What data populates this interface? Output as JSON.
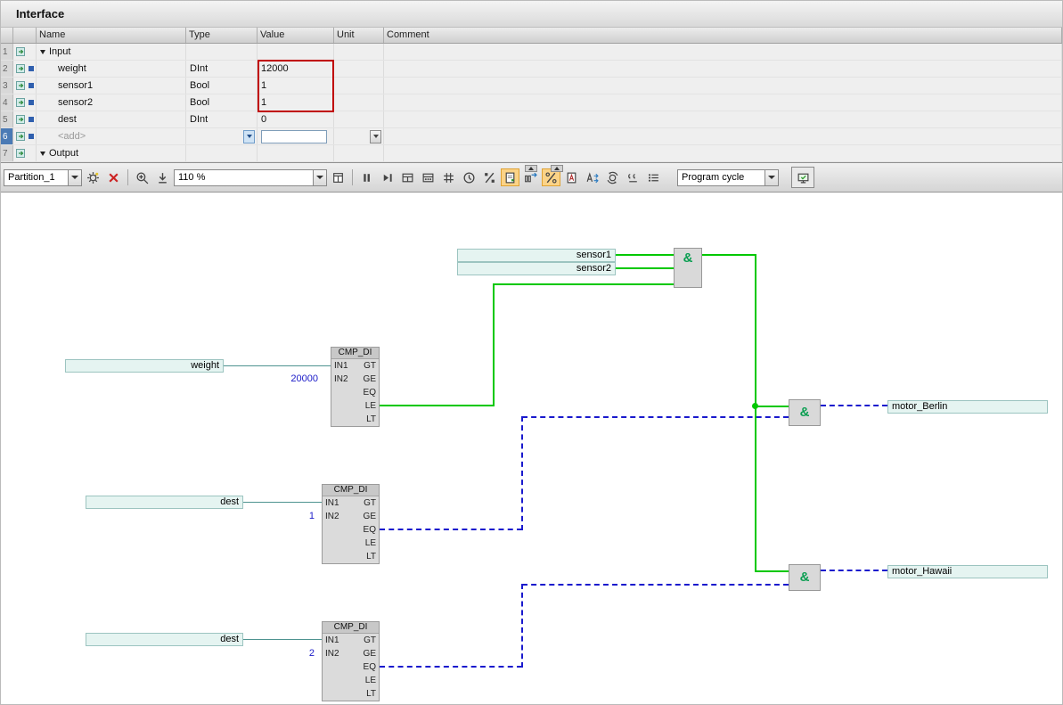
{
  "interface": {
    "title": "Interface",
    "columns": {
      "name": "Name",
      "type": "Type",
      "value": "Value",
      "unit": "Unit",
      "comment": "Comment"
    },
    "rows": [
      {
        "num": "1",
        "kind": "group",
        "name": "Input"
      },
      {
        "num": "2",
        "kind": "var",
        "name": "weight",
        "type": "DInt",
        "value": "12000"
      },
      {
        "num": "3",
        "kind": "var",
        "name": "sensor1",
        "type": "Bool",
        "value": "1"
      },
      {
        "num": "4",
        "kind": "var",
        "name": "sensor2",
        "type": "Bool",
        "value": "1"
      },
      {
        "num": "5",
        "kind": "var",
        "name": "dest",
        "type": "DInt",
        "value": "0"
      },
      {
        "num": "6",
        "kind": "add",
        "name": "<add>"
      },
      {
        "num": "7",
        "kind": "group",
        "name": "Output"
      }
    ],
    "value_highlight_color": "#c00000"
  },
  "toolbar": {
    "partition": "Partition_1",
    "zoom_level": "110 %",
    "cycle": "Program cycle",
    "icons": [
      "gear-icon",
      "close-x-icon",
      "zoom-in-icon",
      "zoom-fit-icon",
      "window-icon",
      "bars-icon",
      "play-bar-icon",
      "table-icon",
      "dot-grid-icon",
      "hash-grid-icon",
      "clock-icon",
      "one-over-x-icon",
      "document-star-icon",
      "io-arrows-icon",
      "percent-slash-icon",
      "document-a-icon",
      "letter-a-arrows-icon",
      "gear-arrows-icon",
      "quotes-icon",
      "list-icon",
      "display-icon"
    ],
    "active_icons": [
      "document-star-icon",
      "percent-slash-icon"
    ]
  },
  "fbd": {
    "and_label": "&",
    "cmp_title": "CMP_DI",
    "ports": {
      "in1": "IN1",
      "in2": "IN2",
      "gt": "GT",
      "ge": "GE",
      "eq": "EQ",
      "le": "LE",
      "lt": "LT"
    },
    "operands": {
      "weight": "weight",
      "sensor1": "sensor1",
      "sensor2": "sensor2",
      "dest1": "dest",
      "dest2": "dest",
      "motor_berlin": "motor_Berlin",
      "motor_hawaii": "motor_Hawaii"
    },
    "constants": {
      "weight_limit": "20000",
      "dest_berlin": "1",
      "dest_hawaii": "2"
    },
    "colors": {
      "true_flow": "#00c800",
      "false_flow": "#1a1acd",
      "operand_wire": "#4e9390"
    }
  }
}
